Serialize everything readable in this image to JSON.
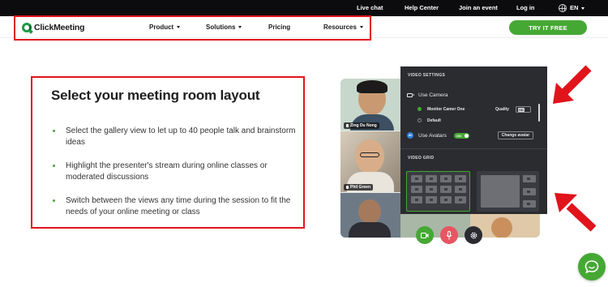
{
  "topbar": {
    "live_chat": "Live chat",
    "help_center": "Help Center",
    "join_event": "Join an event",
    "log_in": "Log in",
    "language": "EN"
  },
  "header": {
    "logo_text": "ClickMeeting",
    "nav": [
      "Product",
      "Solutions",
      "Pricing",
      "Resources"
    ],
    "cta": "TRY IT FREE"
  },
  "content": {
    "title": "Select your meeting room layout",
    "bullets": [
      "Select the gallery view to let up to 40 people talk and brainstorm ideas",
      "Highlight the presenter's stream during online classes or moderated discussions",
      "Switch between the views any time during the session to fit the needs of your online meeting or class"
    ]
  },
  "illustration": {
    "participants": [
      "Zing Du Nong",
      "Phil Green"
    ],
    "panel": {
      "video_settings_heading": "VIDEO SETTINGS",
      "use_camera": "Use Camera",
      "camera_option_1": "Monitor Camer One",
      "camera_option_2": "Default",
      "quality_label": "Quality",
      "use_avatars": "Use Avatars",
      "toggle_state": "ON",
      "change_avatar": "Change avatar",
      "video_grid_heading": "VIDEO GRID"
    }
  },
  "colors": {
    "accent_green": "#45a834",
    "annotation_red": "#e1131b",
    "topbar_bg": "#0c0c0e",
    "panel_bg": "#2b2c30",
    "mic_red": "#e85562"
  },
  "icons": {
    "globe": "globe-icon",
    "camera": "camera-icon",
    "microphone": "microphone-icon",
    "settings": "gear-icon",
    "chat": "chat-bubble-icon"
  }
}
